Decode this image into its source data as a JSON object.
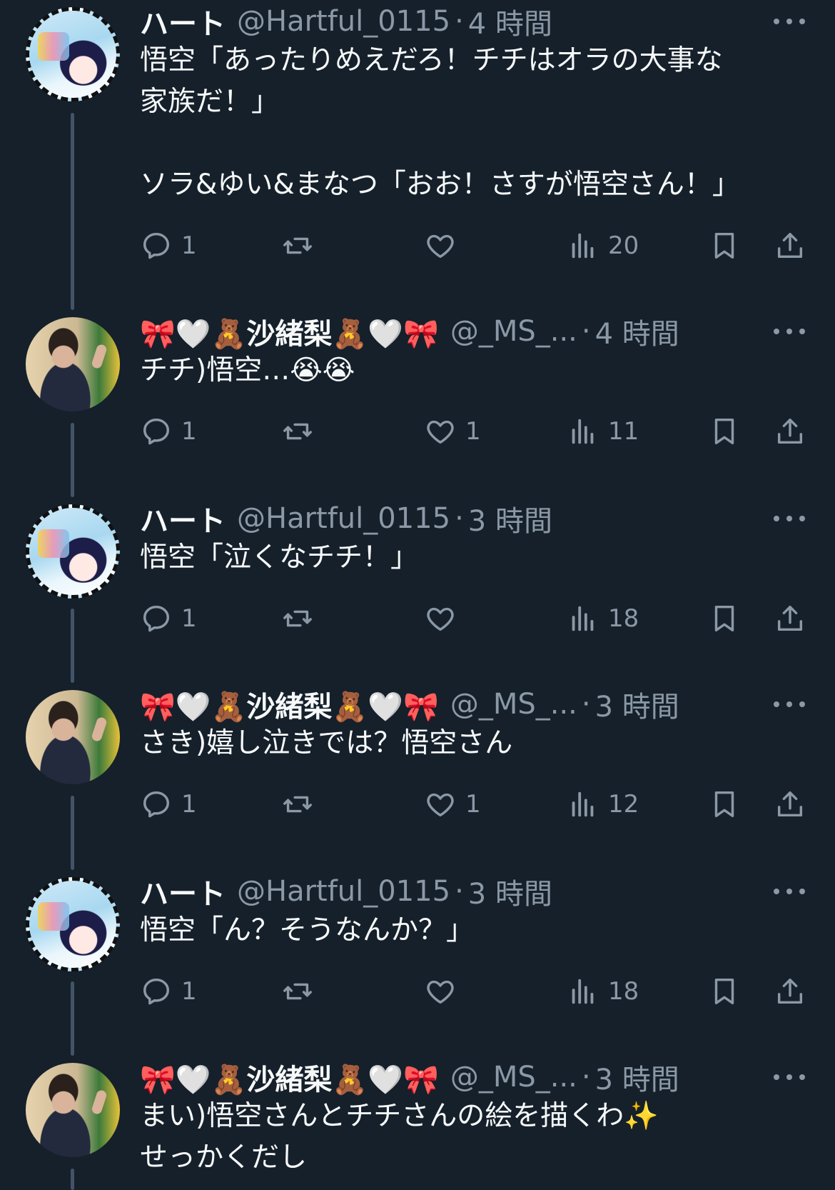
{
  "tweets": [
    {
      "name": "ハート",
      "handle": "@Hartful_0115",
      "time": "4 時間",
      "text": "悟空「あったりめえだろ！チチはオラの大事な\n家族だ！」\n\nソラ&ゆい&まなつ「おお！さすが悟空さん！」",
      "replies": "1",
      "retweets": "",
      "likes": "",
      "views": "20",
      "avatar": "anime"
    },
    {
      "name": "🎀🤍🧸沙緒梨🧸🤍🎀",
      "handle": "@_MS_...",
      "time": "4 時間",
      "text": "チチ)悟空…😭😭",
      "replies": "1",
      "retweets": "",
      "likes": "1",
      "views": "11",
      "avatar": "person"
    },
    {
      "name": "ハート",
      "handle": "@Hartful_0115",
      "time": "3 時間",
      "text": "悟空「泣くなチチ！」",
      "replies": "1",
      "retweets": "",
      "likes": "",
      "views": "18",
      "avatar": "anime"
    },
    {
      "name": "🎀🤍🧸沙緒梨🧸🤍🎀",
      "handle": "@_MS_...",
      "time": "3 時間",
      "text": "さき)嬉し泣きでは？悟空さん",
      "replies": "1",
      "retweets": "",
      "likes": "1",
      "views": "12",
      "avatar": "person"
    },
    {
      "name": "ハート",
      "handle": "@Hartful_0115",
      "time": "3 時間",
      "text": "悟空「ん？そうなんか？」",
      "replies": "1",
      "retweets": "",
      "likes": "",
      "views": "18",
      "avatar": "anime"
    },
    {
      "name": "🎀🤍🧸沙緒梨🧸🤍🎀",
      "handle": "@_MS_...",
      "time": "3 時間",
      "text": "まい)悟空さんとチチさんの絵を描くわ✨\nせっかくだし",
      "replies": "",
      "retweets": "",
      "likes": "",
      "views": "",
      "avatar": "person"
    }
  ],
  "sep": "·",
  "icons": {
    "reply": "reply-icon",
    "retweet": "retweet-icon",
    "like": "heart-icon",
    "views": "views-icon",
    "bookmark": "bookmark-icon",
    "share": "share-icon",
    "more": "more-icon"
  }
}
